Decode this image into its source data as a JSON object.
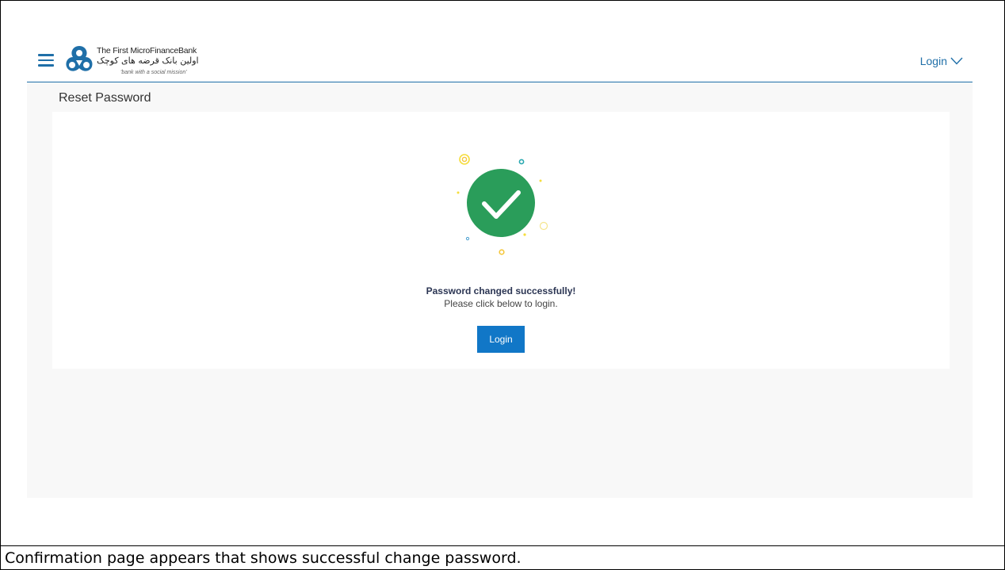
{
  "header": {
    "logo_en": "The First MicroFinanceBank",
    "logo_fa": "اولین بانک قرضه های کوچک",
    "logo_tagline": "'bank with a social mission'",
    "login_menu_label": "Login"
  },
  "page": {
    "title": "Reset Password"
  },
  "confirmation": {
    "title": "Password changed successfully!",
    "subtitle": "Please click below to login.",
    "login_button": "Login"
  },
  "caption": "Confirmation page appears that shows successful change password.",
  "colors": {
    "brand": "#1f6fa8",
    "success": "#2a9d5a",
    "button": "#1177c7"
  },
  "icons": [
    "menu-icon",
    "bank-logo-icon",
    "chevron-down-icon",
    "check-circle-icon"
  ]
}
